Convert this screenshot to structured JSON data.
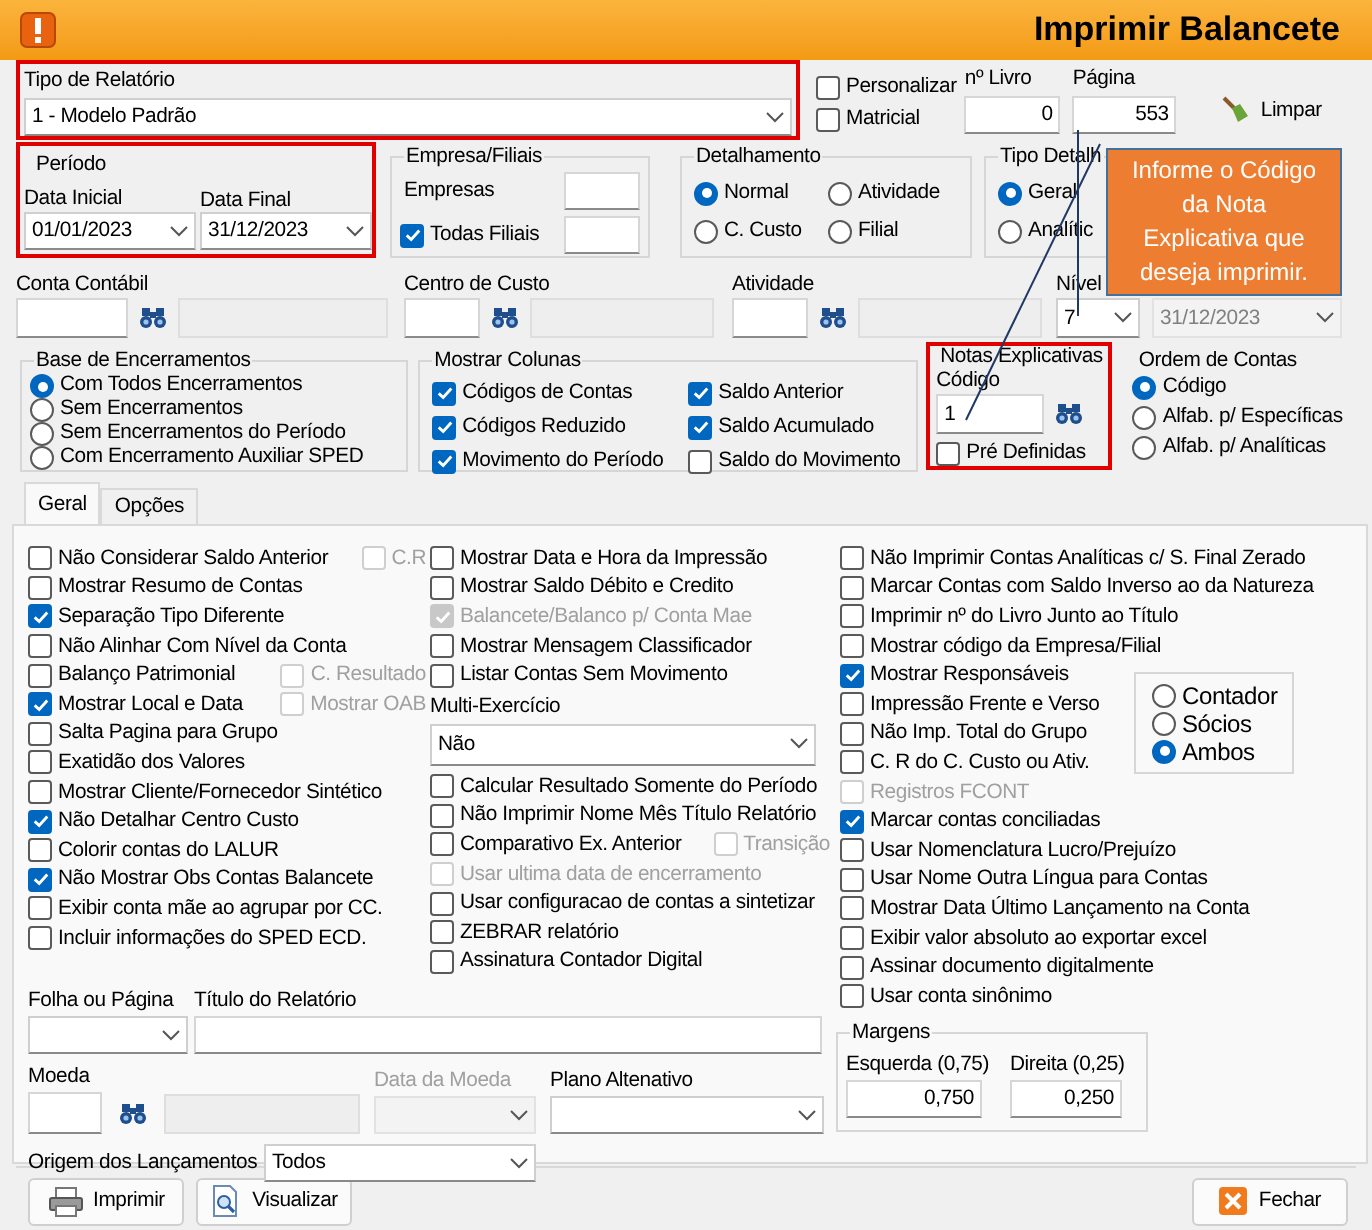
{
  "window": {
    "title": "Imprimir Balancete"
  },
  "tipo_relatorio": {
    "label": "Tipo de Relatório",
    "value": "1 - Modelo Padrão"
  },
  "print_options": [
    {
      "label": "Personalizar",
      "checked": false
    },
    {
      "label": "Matricial",
      "checked": false
    }
  ],
  "livro": {
    "label": "nº Livro",
    "value": "0"
  },
  "pagina": {
    "label": "Página",
    "value": "553"
  },
  "limpar_button": {
    "label": "Limpar"
  },
  "periodo": {
    "title": "Período",
    "data_inicial_label": "Data Inicial",
    "data_inicial": "01/01/2023",
    "data_final_label": "Data Final",
    "data_final": "31/12/2023"
  },
  "empresa_filiais": {
    "title": "Empresa/Filiais",
    "empresas_label": "Empresas",
    "todas_filiais": {
      "label": "Todas Filiais",
      "checked": true
    }
  },
  "detalhamento": {
    "title": "Detalhamento",
    "options": [
      {
        "label": "Normal",
        "selected": true
      },
      {
        "label": "Atividade",
        "selected": false
      },
      {
        "label": "C. Custo",
        "selected": false
      },
      {
        "label": "Filial",
        "selected": false
      }
    ]
  },
  "tipo_detalhe": {
    "title": "Tipo Detalh",
    "options": [
      {
        "label": "Geral",
        "selected": true
      },
      {
        "label": "Analític",
        "selected": false
      }
    ]
  },
  "filters": {
    "conta_contabil": "Conta Contábil",
    "centro_custo": "Centro de Custo",
    "atividade": "Atividade",
    "nivel_label": "Nível",
    "nivel": "7",
    "data": "31/12/2023"
  },
  "base_encerramentos": {
    "title": "Base de Encerramentos",
    "options": [
      {
        "label": "Com Todos Encerramentos",
        "selected": true
      },
      {
        "label": "Sem Encerramentos",
        "selected": false
      },
      {
        "label": "Sem Encerramentos do Período",
        "selected": false
      },
      {
        "label": "Com Encerramento Auxiliar SPED",
        "selected": false
      }
    ]
  },
  "mostrar_colunas": {
    "title": "Mostrar Colunas",
    "items": [
      {
        "label": "Códigos de Contas",
        "checked": true
      },
      {
        "label": "Códigos Reduzido",
        "checked": true
      },
      {
        "label": "Movimento do Período",
        "checked": true
      },
      {
        "label": "Saldo Anterior",
        "checked": true
      },
      {
        "label": "Saldo Acumulado",
        "checked": true
      },
      {
        "label": "Saldo do Movimento",
        "checked": false
      }
    ]
  },
  "notas_explicativas": {
    "title": "Notas Explicativas",
    "codigo_label": "Código",
    "codigo": "1",
    "pre_definidas": {
      "label": "Pré Definidas",
      "checked": false
    }
  },
  "ordem_contas": {
    "title": "Ordem de Contas",
    "options": [
      {
        "label": "Código",
        "selected": true
      },
      {
        "label": "Alfab. p/  Específicas",
        "selected": false
      },
      {
        "label": "Alfab. p/ Analíticas",
        "selected": false
      }
    ]
  },
  "tabs": [
    {
      "label": "Geral",
      "selected": true
    },
    {
      "label": "Opções",
      "selected": false
    }
  ],
  "column_1": [
    {
      "kind": "checkbox",
      "label": "Não Considerar Saldo Anterior",
      "checked": false,
      "disabled": false,
      "extra": {
        "label": "C.R",
        "checked": false,
        "disabled": true
      }
    },
    {
      "kind": "checkbox",
      "label": "Mostrar Resumo de Contas",
      "checked": false,
      "disabled": false
    },
    {
      "kind": "checkbox",
      "label": "Separação Tipo Diferente",
      "checked": true,
      "disabled": false
    },
    {
      "kind": "checkbox",
      "label": "Não Alinhar Com Nível da Conta",
      "checked": false,
      "disabled": false
    },
    {
      "kind": "checkbox",
      "label": "Balanço Patrimonial",
      "checked": false,
      "disabled": false,
      "extra": {
        "label": "C. Resultado",
        "checked": false,
        "disabled": true
      }
    },
    {
      "kind": "checkbox",
      "label": "Mostrar Local e Data",
      "checked": true,
      "disabled": false,
      "extra": {
        "label": "Mostrar OAB",
        "checked": false,
        "disabled": true
      }
    },
    {
      "kind": "checkbox",
      "label": "Salta Pagina para Grupo",
      "checked": false,
      "disabled": false
    },
    {
      "kind": "checkbox",
      "label": "Exatidão dos Valores",
      "checked": false,
      "disabled": false
    },
    {
      "kind": "checkbox",
      "label": "Mostrar Cliente/Fornecedor Sintético",
      "checked": false,
      "disabled": false
    },
    {
      "kind": "checkbox",
      "label": "Não Detalhar Centro Custo",
      "checked": true,
      "disabled": false
    },
    {
      "kind": "checkbox",
      "label": "Colorir contas do LALUR",
      "checked": false,
      "disabled": false
    },
    {
      "kind": "checkbox",
      "label": "Não Mostrar Obs Contas Balancete",
      "checked": true,
      "disabled": false
    },
    {
      "kind": "checkbox",
      "label": "Exibir conta mãe ao agrupar por CC.",
      "checked": false,
      "disabled": false
    },
    {
      "kind": "checkbox",
      "label": "Incluir informações do SPED ECD.",
      "checked": false,
      "disabled": false
    }
  ],
  "column_2": [
    {
      "kind": "checkbox",
      "label": "Mostrar Data e Hora da Impressão",
      "checked": false,
      "disabled": false
    },
    {
      "kind": "checkbox",
      "label": "Mostrar Saldo Débito e Credito",
      "checked": false,
      "disabled": false
    },
    {
      "kind": "checkbox",
      "label": "Balancete/Balanco p/ Conta Mae",
      "checked": true,
      "disabled": true
    },
    {
      "kind": "checkbox",
      "label": "Mostrar Mensagem Classificador",
      "checked": false,
      "disabled": false
    },
    {
      "kind": "checkbox",
      "label": "Listar Contas Sem Movimento",
      "checked": false,
      "disabled": false
    },
    {
      "kind": "select",
      "label": "Multi-Exercício",
      "value": "Não"
    },
    {
      "kind": "checkbox",
      "label": "Calcular Resultado Somente do Período",
      "checked": false,
      "disabled": false
    },
    {
      "kind": "checkbox",
      "label": "Não Imprimir Nome Mês Título Relatório",
      "checked": false,
      "disabled": false
    },
    {
      "kind": "checkbox",
      "label": "Comparativo Ex. Anterior",
      "checked": false,
      "disabled": false,
      "extra": {
        "label": "Transição",
        "checked": false,
        "disabled": true
      }
    },
    {
      "kind": "checkbox",
      "label": "Usar ultima data de encerramento",
      "checked": false,
      "disabled": true
    },
    {
      "kind": "checkbox",
      "label": "Usar configuracao de contas a sintetizar",
      "checked": false,
      "disabled": false
    },
    {
      "kind": "checkbox",
      "label": "ZEBRAR relatório",
      "checked": false,
      "disabled": false
    },
    {
      "kind": "checkbox",
      "label": "Assinatura Contador Digital",
      "checked": false,
      "disabled": false
    }
  ],
  "column_3": [
    {
      "kind": "checkbox",
      "label": "Não Imprimir Contas Analíticas c/ S. Final Zerado",
      "checked": false,
      "disabled": false
    },
    {
      "kind": "checkbox",
      "label": "Marcar Contas com Saldo Inverso ao da Natureza",
      "checked": false,
      "disabled": false
    },
    {
      "kind": "checkbox",
      "label": "Imprimir nº do Livro Junto ao Título",
      "checked": false,
      "disabled": false
    },
    {
      "kind": "checkbox",
      "label": "Mostrar código da Empresa/Filial",
      "checked": false,
      "disabled": false
    },
    {
      "kind": "checkbox",
      "label": "Mostrar Responsáveis",
      "checked": true,
      "disabled": false
    },
    {
      "kind": "checkbox",
      "label": "Impressão Frente e Verso",
      "checked": false,
      "disabled": false
    },
    {
      "kind": "checkbox",
      "label": "Não Imp. Total do Grupo",
      "checked": false,
      "disabled": false
    },
    {
      "kind": "checkbox",
      "label": "C. R do C. Custo ou Ativ.",
      "checked": false,
      "disabled": false
    },
    {
      "kind": "checkbox",
      "label": "Registros FCONT",
      "checked": false,
      "disabled": true
    },
    {
      "kind": "checkbox",
      "label": "Marcar contas conciliadas",
      "checked": true,
      "disabled": false
    },
    {
      "kind": "checkbox",
      "label": "Usar Nomenclatura Lucro/Prejuízo",
      "checked": false,
      "disabled": false
    },
    {
      "kind": "checkbox",
      "label": "Usar Nome Outra Língua para Contas",
      "checked": false,
      "disabled": false
    },
    {
      "kind": "checkbox",
      "label": "Mostrar Data Último Lançamento na Conta",
      "checked": false,
      "disabled": false
    },
    {
      "kind": "checkbox",
      "label": "Exibir valor absoluto ao exportar excel",
      "checked": false,
      "disabled": false
    },
    {
      "kind": "checkbox",
      "label": "Assinar documento digitalmente",
      "checked": false,
      "disabled": false
    },
    {
      "kind": "checkbox",
      "label": "Usar conta sinônimo",
      "checked": false,
      "disabled": false
    }
  ],
  "responsaveis": {
    "options": [
      {
        "label": "Contador",
        "selected": false
      },
      {
        "label": "Sócios",
        "selected": false
      },
      {
        "label": "Ambos",
        "selected": true
      }
    ]
  },
  "folha_pagina": {
    "label": "Folha ou Página"
  },
  "titulo_relatorio": {
    "label": "Título do Relatório"
  },
  "moeda": {
    "label": "Moeda"
  },
  "data_moeda": {
    "label": "Data da Moeda",
    "disabled": true
  },
  "plano_alternativo": {
    "label": "Plano Altenativo"
  },
  "origem": {
    "label": "Origem dos Lançamentos",
    "value": "Todos"
  },
  "margens": {
    "title": "Margens",
    "esquerda_label": "Esquerda (0,75)",
    "esquerda": "0,750",
    "direita_label": "Direita (0,25)",
    "direita": "0,250"
  },
  "buttons": [
    {
      "label": "Imprimir",
      "kind": "print"
    },
    {
      "label": "Visualizar",
      "kind": "preview"
    },
    {
      "label": "Fechar",
      "kind": "close"
    }
  ],
  "callout": {
    "text": "Informe o Código da Nota Explicativa que deseja imprimir."
  }
}
